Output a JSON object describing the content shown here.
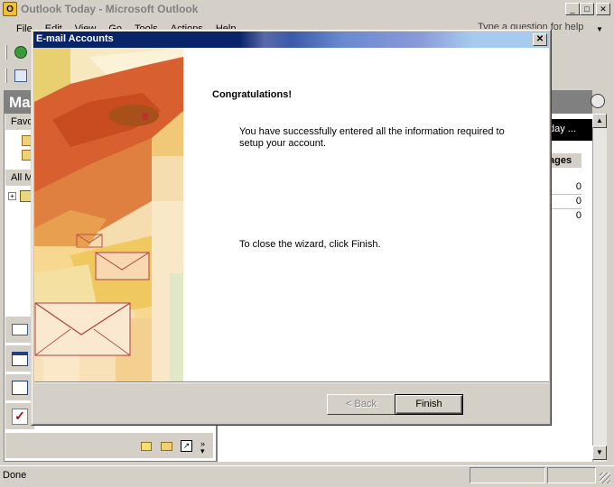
{
  "main_window": {
    "title": "Outlook Today - Microsoft Outlook",
    "app_icon": "O",
    "controls": {
      "minimize": "_",
      "maximize": "□",
      "close": "✕"
    },
    "menu": [
      "File",
      "Edit",
      "View",
      "Go",
      "Tools",
      "Actions",
      "Help"
    ],
    "help_placeholder": "Type a question for help",
    "nav_header": "Mai",
    "favorites_label": "Favo",
    "all_mail_label": "All Ma",
    "right_pane": {
      "blackbar_text": "day ...",
      "messages_header": "ages",
      "counts": [
        "0",
        "0",
        "0"
      ]
    },
    "status": "Done"
  },
  "dialog": {
    "title": "E-mail Accounts",
    "heading": "Congratulations!",
    "message": "You have successfully entered all the information required to setup your account.",
    "instruction": "To close the wizard, click Finish.",
    "buttons": {
      "back": "< Back",
      "finish": "Finish"
    },
    "close": "✕"
  },
  "colors": {
    "title_active": "#0a246a",
    "title_gradient_end": "#a6caf0",
    "chrome": "#d4d0c8"
  }
}
